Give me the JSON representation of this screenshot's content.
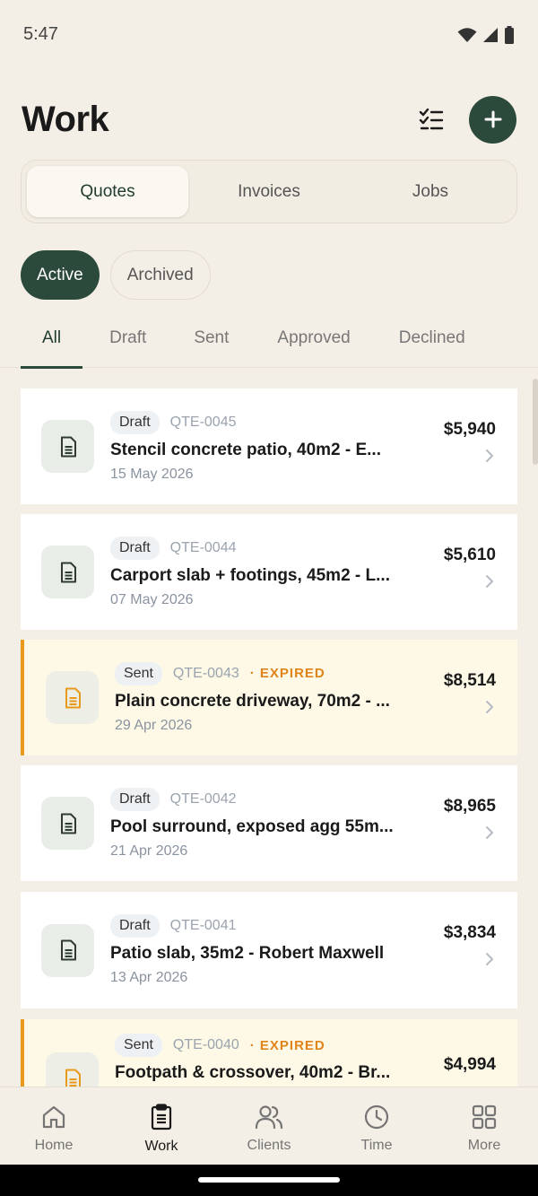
{
  "status_bar": {
    "time": "5:47"
  },
  "header": {
    "title": "Work"
  },
  "segments": [
    {
      "label": "Quotes",
      "active": true
    },
    {
      "label": "Invoices",
      "active": false
    },
    {
      "label": "Jobs",
      "active": false
    }
  ],
  "filters": {
    "active_label": "Active",
    "archived_label": "Archived"
  },
  "status_tabs": [
    "All",
    "Draft",
    "Sent",
    "Approved",
    "Declined"
  ],
  "quotes": [
    {
      "status": "Draft",
      "id": "QTE-0045",
      "expired": "",
      "title": "Stencil concrete patio, 40m2 - E...",
      "date": "15 May 2026",
      "amount": "$5,940"
    },
    {
      "status": "Draft",
      "id": "QTE-0044",
      "expired": "",
      "title": "Carport slab + footings, 45m2 - L...",
      "date": "07 May 2026",
      "amount": "$5,610"
    },
    {
      "status": "Sent",
      "id": "QTE-0043",
      "expired": "· EXPIRED",
      "title": "Plain concrete driveway, 70m2 - ...",
      "date": "29 Apr 2026",
      "amount": "$8,514"
    },
    {
      "status": "Draft",
      "id": "QTE-0042",
      "expired": "",
      "title": "Pool surround, exposed agg 55m...",
      "date": "21 Apr 2026",
      "amount": "$8,965"
    },
    {
      "status": "Draft",
      "id": "QTE-0041",
      "expired": "",
      "title": "Patio slab, 35m2 - Robert Maxwell",
      "date": "13 Apr 2026",
      "amount": "$3,834"
    },
    {
      "status": "Sent",
      "id": "QTE-0040",
      "expired": "· EXPIRED",
      "title": "Footpath & crossover, 40m2 - Br...",
      "date": "",
      "amount": "$4,994"
    }
  ],
  "bottom_nav": [
    {
      "label": "Home",
      "icon": "home-icon"
    },
    {
      "label": "Work",
      "icon": "clipboard-icon"
    },
    {
      "label": "Clients",
      "icon": "people-icon"
    },
    {
      "label": "Time",
      "icon": "clock-icon"
    },
    {
      "label": "More",
      "icon": "grid-icon"
    }
  ],
  "colors": {
    "accent": "#2c4a3c",
    "expired": "#e0841a",
    "background": "#f4efe6"
  }
}
